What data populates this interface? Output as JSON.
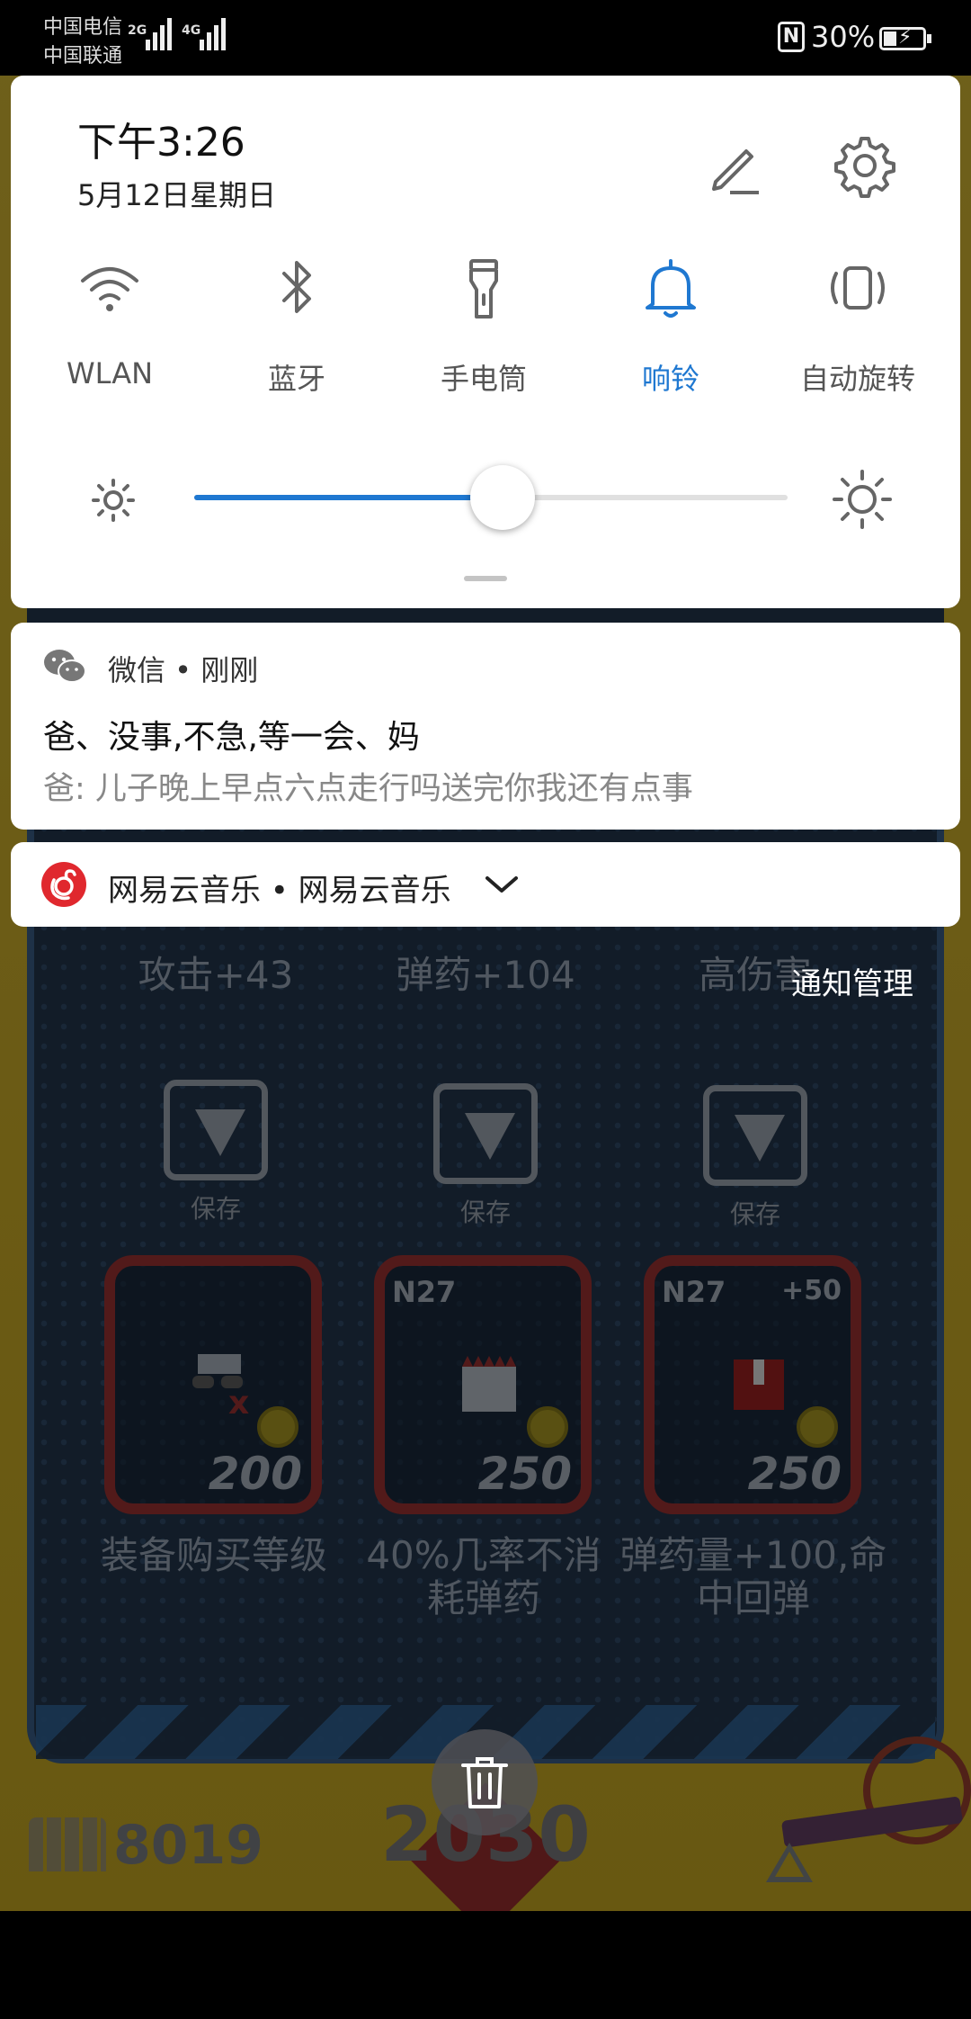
{
  "status_bar": {
    "carrier1": "中国电信",
    "carrier2": "中国联通",
    "net1": "2G",
    "net2": "4G",
    "nfc": "N",
    "battery": "30%"
  },
  "quick_settings": {
    "time": "下午3:26",
    "date": "5月12日星期日",
    "tiles": [
      {
        "label": "WLAN",
        "icon": "wifi-icon",
        "active": false
      },
      {
        "label": "蓝牙",
        "icon": "bluetooth-icon",
        "active": false
      },
      {
        "label": "手电筒",
        "icon": "flashlight-icon",
        "active": false
      },
      {
        "label": "响铃",
        "icon": "bell-icon",
        "active": true
      },
      {
        "label": "自动旋转",
        "icon": "auto-rotate-icon",
        "active": false
      }
    ],
    "brightness_level": 0.52,
    "accent_color": "#1f78d1"
  },
  "notifications": {
    "wechat": {
      "header": "微信 • 刚刚",
      "title": "爸、没事,不急,等一会、妈",
      "body": "爸: 儿子晚上早点六点走行吗送完你我还有点事"
    },
    "music": {
      "header": "网易云音乐 • 网易云音乐"
    },
    "manage_label": "通知管理"
  },
  "game": {
    "stats": [
      "攻击+43",
      "弹药+104",
      "高伤害"
    ],
    "save_label": "保存",
    "cards": [
      {
        "level": "",
        "bonus": "",
        "price": "200",
        "desc": "装备购买等级"
      },
      {
        "level": "N27",
        "bonus": "",
        "price": "250",
        "desc": "40%几率不消耗弹药"
      },
      {
        "level": "N27",
        "bonus": "+50",
        "price": "250",
        "desc": "弹药量+100,命中回弹"
      }
    ],
    "ammo": "8019",
    "score": "2030"
  }
}
